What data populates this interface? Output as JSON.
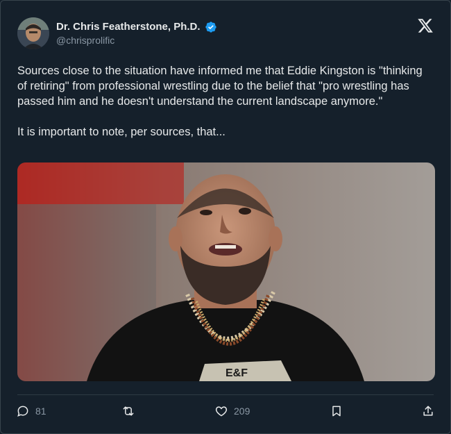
{
  "author": {
    "name": "Dr. Chris Featherstone, Ph.D.",
    "handle": "@chrisprolific",
    "verified_color": "#1d9bf0",
    "avatar_icon": "profile-photo"
  },
  "brand_icon": "x-logo",
  "tweet": {
    "paragraph_1": "Sources close to the situation have informed me that Eddie Kingston is \"thinking of retiring\" from professional wrestling due to the belief that \"pro wrestling has passed him and he doesn't understand the current landscape anymore.\"",
    "paragraph_2": "It is important to note, per sources, that..."
  },
  "media": {
    "shirt_text": "E&F"
  },
  "actions": {
    "reply_count": "81",
    "repost_count": "",
    "like_count": "209"
  },
  "colors": {
    "background": "#15202b",
    "text": "#e7e9ea",
    "muted": "#8b98a5",
    "accent": "#1d9bf0"
  }
}
